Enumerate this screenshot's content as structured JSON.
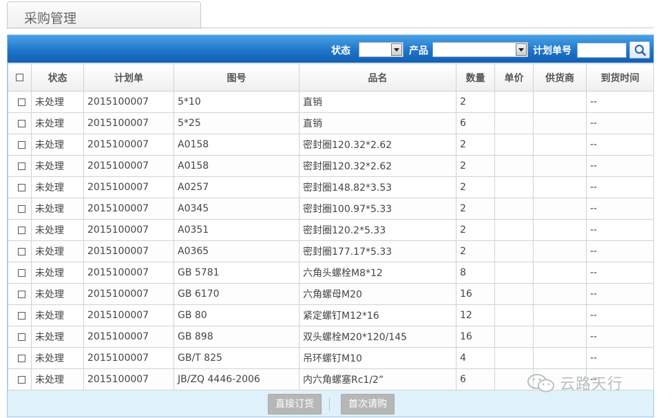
{
  "page": {
    "tab_title": "采购管理"
  },
  "toolbar": {
    "status_label": "状态",
    "status_value": "",
    "product_label": "产品",
    "product_value": "",
    "plan_no_label": "计划单号",
    "plan_no_value": "",
    "search_icon": "search-icon"
  },
  "table": {
    "headers": [
      "状态",
      "计划单",
      "图号",
      "品名",
      "数量",
      "单价",
      "供货商",
      "到货时间"
    ],
    "rows": [
      {
        "status": "未处理",
        "plan": "2015100007",
        "drawing": "5*10",
        "name": "直销",
        "qty": "2",
        "price": "",
        "supplier": "",
        "arrival": "--"
      },
      {
        "status": "未处理",
        "plan": "2015100007",
        "drawing": "5*25",
        "name": "直销",
        "qty": "6",
        "price": "",
        "supplier": "",
        "arrival": "--"
      },
      {
        "status": "未处理",
        "plan": "2015100007",
        "drawing": "A0158",
        "name": "密封圈120.32*2.62",
        "qty": "2",
        "price": "",
        "supplier": "",
        "arrival": "--"
      },
      {
        "status": "未处理",
        "plan": "2015100007",
        "drawing": "A0158",
        "name": "密封圈120.32*2.62",
        "qty": "2",
        "price": "",
        "supplier": "",
        "arrival": "--"
      },
      {
        "status": "未处理",
        "plan": "2015100007",
        "drawing": "A0257",
        "name": "密封圈148.82*3.53",
        "qty": "2",
        "price": "",
        "supplier": "",
        "arrival": "--"
      },
      {
        "status": "未处理",
        "plan": "2015100007",
        "drawing": "A0345",
        "name": "密封圈100.97*5.33",
        "qty": "2",
        "price": "",
        "supplier": "",
        "arrival": "--"
      },
      {
        "status": "未处理",
        "plan": "2015100007",
        "drawing": "A0351",
        "name": "密封圈120.2*5.33",
        "qty": "2",
        "price": "",
        "supplier": "",
        "arrival": "--"
      },
      {
        "status": "未处理",
        "plan": "2015100007",
        "drawing": "A0365",
        "name": "密封圈177.17*5.33",
        "qty": "2",
        "price": "",
        "supplier": "",
        "arrival": "--"
      },
      {
        "status": "未处理",
        "plan": "2015100007",
        "drawing": "GB 5781",
        "name": "六角头螺栓M8*12",
        "qty": "8",
        "price": "",
        "supplier": "",
        "arrival": "--"
      },
      {
        "status": "未处理",
        "plan": "2015100007",
        "drawing": "GB 6170",
        "name": "六角螺母M20",
        "qty": "16",
        "price": "",
        "supplier": "",
        "arrival": "--"
      },
      {
        "status": "未处理",
        "plan": "2015100007",
        "drawing": "GB 80",
        "name": "紧定螺钉M12*16",
        "qty": "12",
        "price": "",
        "supplier": "",
        "arrival": "--"
      },
      {
        "status": "未处理",
        "plan": "2015100007",
        "drawing": "GB 898",
        "name": "双头螺栓M20*120/145",
        "qty": "16",
        "price": "",
        "supplier": "",
        "arrival": "--"
      },
      {
        "status": "未处理",
        "plan": "2015100007",
        "drawing": "GB/T 825",
        "name": "吊环螺钉M10",
        "qty": "4",
        "price": "",
        "supplier": "",
        "arrival": "--"
      },
      {
        "status": "未处理",
        "plan": "2015100007",
        "drawing": "JB/ZQ 4446-2006",
        "name": "内六角螺塞Rc1/2”",
        "qty": "6",
        "price": "",
        "supplier": "",
        "arrival": "--"
      }
    ]
  },
  "footer": {
    "direct_order_label": "直接订货",
    "first_request_label": "首次请购"
  },
  "watermark": {
    "text": "云路天行"
  },
  "colors": {
    "toolbar_top": "#4aa2e6",
    "toolbar_bottom": "#135fb2",
    "footer_bg": "#dff1fa",
    "button_gray": "#b7b7b7"
  }
}
